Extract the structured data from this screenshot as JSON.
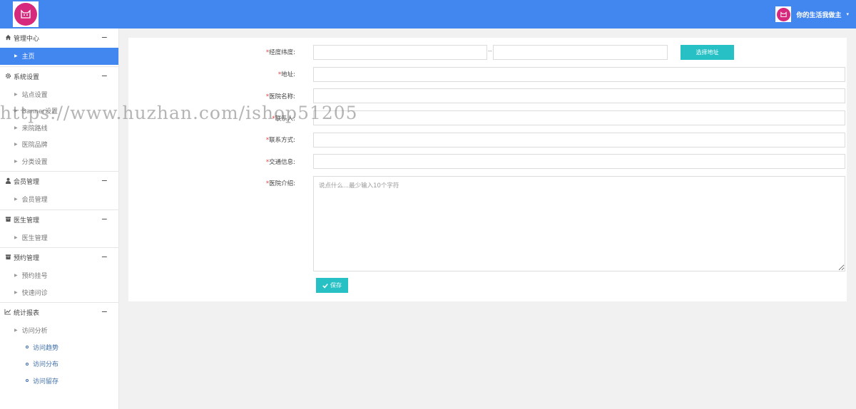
{
  "header": {
    "username": "你的生活我做主",
    "caret": "▾"
  },
  "sidebar": {
    "sections": [
      {
        "title": "管理中心",
        "icon": "home-icon",
        "items": [
          {
            "label": "主页",
            "active": true
          }
        ]
      },
      {
        "title": "系统设置",
        "icon": "gear-icon",
        "items": [
          {
            "label": "站点设置"
          },
          {
            "label": "Banner设置"
          },
          {
            "label": "来院路线"
          },
          {
            "label": "医院品牌"
          },
          {
            "label": "分类设置"
          }
        ]
      },
      {
        "title": "会员管理",
        "icon": "user-icon",
        "items": [
          {
            "label": "会员管理"
          }
        ]
      },
      {
        "title": "医生管理",
        "icon": "archive-icon",
        "items": [
          {
            "label": "医生管理"
          }
        ]
      },
      {
        "title": "预约管理",
        "icon": "archive-icon",
        "items": [
          {
            "label": "预约挂号"
          },
          {
            "label": "快速问诊"
          }
        ]
      },
      {
        "title": "统计报表",
        "icon": "chart-icon",
        "items": [
          {
            "label": "访问分析"
          }
        ],
        "subitems": [
          {
            "label": "访问趋势"
          },
          {
            "label": "访问分布"
          },
          {
            "label": "访问留存"
          }
        ]
      }
    ]
  },
  "form": {
    "latlng_label": "经度纬度:",
    "latlng_sep": "--",
    "pick_address_label": "选择地址",
    "address_label": "地址:",
    "hospital_name_label": "医院名称:",
    "contact_person_label": "联系人:",
    "contact_label": "联系方式:",
    "traffic_label": "交通信息:",
    "intro_label": "医院介绍:",
    "intro_placeholder": "说点什么...最少输入10个字符",
    "required_mark": "*",
    "save_label": "保存"
  },
  "watermark": "https://www.huzhan.com/ishop51205"
}
